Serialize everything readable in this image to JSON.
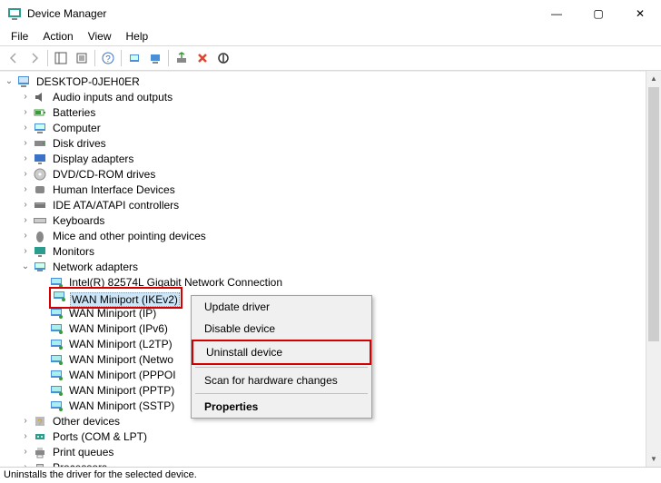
{
  "title": "Device Manager",
  "window_controls": {
    "min": "—",
    "max": "▢",
    "close": "✕"
  },
  "menu": [
    "File",
    "Action",
    "View",
    "Help"
  ],
  "root": "DESKTOP-0JEH0ER",
  "categories": [
    {
      "label": "Audio inputs and outputs",
      "icon": "audio"
    },
    {
      "label": "Batteries",
      "icon": "battery"
    },
    {
      "label": "Computer",
      "icon": "computer"
    },
    {
      "label": "Disk drives",
      "icon": "disk"
    },
    {
      "label": "Display adapters",
      "icon": "display"
    },
    {
      "label": "DVD/CD-ROM drives",
      "icon": "cd"
    },
    {
      "label": "Human Interface Devices",
      "icon": "hid"
    },
    {
      "label": "IDE ATA/ATAPI controllers",
      "icon": "ide"
    },
    {
      "label": "Keyboards",
      "icon": "keyboard"
    },
    {
      "label": "Mice and other pointing devices",
      "icon": "mouse"
    },
    {
      "label": "Monitors",
      "icon": "monitor"
    }
  ],
  "network": {
    "label": "Network adapters",
    "children": [
      "Intel(R) 82574L Gigabit Network Connection",
      "WAN Miniport (IKEv2)",
      "WAN Miniport (IP)",
      "WAN Miniport (IPv6)",
      "WAN Miniport (L2TP)",
      "WAN Miniport (Network Monitor)",
      "WAN Miniport (PPPOE)",
      "WAN Miniport (PPTP)",
      "WAN Miniport (SSTP)"
    ],
    "truncated": {
      "3": "WAN Miniport (IPv6)",
      "4": "WAN Miniport (L2TP)",
      "5": "WAN Miniport (Netwo",
      "6": "WAN Miniport (PPPOI",
      "7": "WAN Miniport (PPTP)",
      "8": "WAN Miniport (SSTP)"
    }
  },
  "after": [
    {
      "label": "Other devices",
      "icon": "other"
    },
    {
      "label": "Ports (COM & LPT)",
      "icon": "port"
    },
    {
      "label": "Print queues",
      "icon": "printer"
    },
    {
      "label": "Processors",
      "icon": "cpu"
    }
  ],
  "context_menu": {
    "update": "Update driver",
    "disable": "Disable device",
    "uninstall": "Uninstall device",
    "scan": "Scan for hardware changes",
    "properties": "Properties"
  },
  "status": "Uninstalls the driver for the selected device.",
  "selected_device_index": 1
}
